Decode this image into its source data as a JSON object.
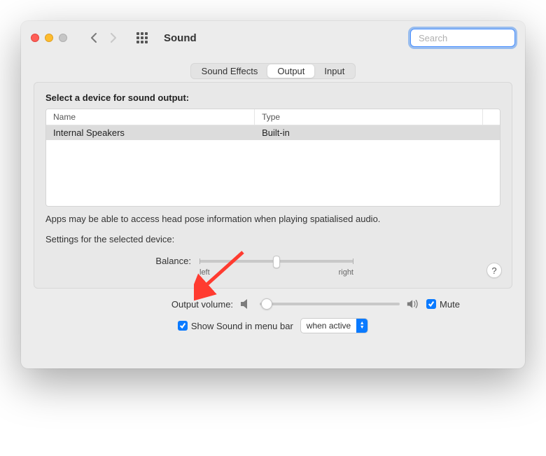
{
  "header": {
    "title": "Sound",
    "search_placeholder": "Search"
  },
  "tabs": {
    "items": [
      "Sound Effects",
      "Output",
      "Input"
    ],
    "active": "Output"
  },
  "panel": {
    "title": "Select a device for sound output:",
    "columns": {
      "name": "Name",
      "type": "Type"
    },
    "devices": [
      {
        "name": "Internal Speakers",
        "type": "Built-in"
      }
    ],
    "note": "Apps may be able to access head pose information when playing spatialised audio.",
    "settings_title": "Settings for the selected device:",
    "balance_label": "Balance:",
    "balance_left": "left",
    "balance_right": "right"
  },
  "footer": {
    "output_volume_label": "Output volume:",
    "mute_label": "Mute",
    "show_in_menubar_label": "Show Sound in menu bar",
    "when_active": "when active"
  }
}
